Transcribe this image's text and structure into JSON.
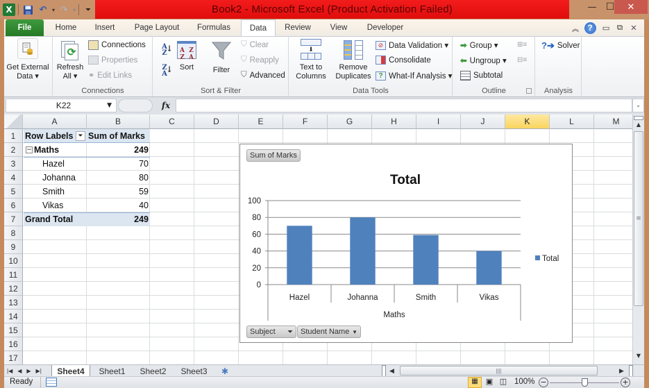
{
  "window": {
    "title": "Book2  -  Microsoft Excel (Product Activation Failed)",
    "title_color": "#e8141a",
    "minimize_label": "—",
    "maximize_label": "☐",
    "close_label": "✕"
  },
  "quick_access": {
    "excel_icon": "X",
    "save_icon": "💾",
    "undo_icon": "↶",
    "redo_icon": "↷",
    "customize_icon": "⏷"
  },
  "tabs": [
    {
      "label": "File"
    },
    {
      "label": "Home"
    },
    {
      "label": "Insert"
    },
    {
      "label": "Page Layout"
    },
    {
      "label": "Formulas"
    },
    {
      "label": "Data"
    },
    {
      "label": "Review"
    },
    {
      "label": "View"
    },
    {
      "label": "Developer"
    }
  ],
  "ribbon_right_icons": {
    "collapse": "︽",
    "help": "?",
    "minimize": "▭",
    "restore": "⧉",
    "close": "✕"
  },
  "ribbon": {
    "get_external_data": {
      "line1": "Get External",
      "line2": "Data ▾"
    },
    "connections_group": {
      "label": "Connections",
      "refresh_all": {
        "line1": "Refresh",
        "line2": "All ▾"
      },
      "connections": "Connections",
      "properties": "Properties",
      "edit_links": "Edit Links"
    },
    "sort_filter_group": {
      "label": "Sort & Filter",
      "sort_az": "A↓Z",
      "sort_za": "Z↓A",
      "sort": "Sort",
      "filter": "Filter",
      "clear": "Clear",
      "reapply": "Reapply",
      "advanced": "Advanced"
    },
    "data_tools_group": {
      "label": "Data Tools",
      "text_to_columns": {
        "line1": "Text to",
        "line2": "Columns"
      },
      "remove_duplicates": {
        "line1": "Remove",
        "line2": "Duplicates"
      },
      "data_validation": "Data Validation ▾",
      "consolidate": "Consolidate",
      "what_if": "What-If Analysis ▾"
    },
    "outline_group": {
      "label": "Outline",
      "group": "Group ▾",
      "ungroup": "Ungroup ▾",
      "subtotal": "Subtotal"
    },
    "analysis_group": {
      "label": "Analysis",
      "solver": "Solver"
    }
  },
  "formula_bar": {
    "name_box": "K22",
    "fx_label": "fx",
    "formula": ""
  },
  "columns": [
    "A",
    "B",
    "C",
    "D",
    "E",
    "F",
    "G",
    "H",
    "I",
    "J",
    "K",
    "L",
    "M"
  ],
  "selected_column": "K",
  "rows": [
    "1",
    "2",
    "3",
    "4",
    "5",
    "6",
    "7",
    "8",
    "9",
    "10",
    "11",
    "12",
    "13",
    "14",
    "15",
    "16",
    "17"
  ],
  "pivot_table": {
    "header_row_labels": "Row Labels",
    "header_sum": "Sum of Marks",
    "group": {
      "label": "Maths",
      "value": "249",
      "collapse_icon": "⊟"
    },
    "items": [
      {
        "label": "Hazel",
        "value": "70"
      },
      {
        "label": "Johanna",
        "value": "80"
      },
      {
        "label": "Smith",
        "value": "59"
      },
      {
        "label": "Vikas",
        "value": "40"
      }
    ],
    "grand_total": {
      "label": "Grand Total",
      "value": "249"
    }
  },
  "chart_data": {
    "type": "bar",
    "title": "Total",
    "categories": [
      "Hazel",
      "Johanna",
      "Smith",
      "Vikas"
    ],
    "group_label": "Maths",
    "series": [
      {
        "name": "Total",
        "values": [
          70,
          80,
          59,
          40
        ],
        "color": "#4f81bd"
      }
    ],
    "ylim": [
      0,
      100
    ],
    "yticks": [
      0,
      20,
      40,
      60,
      80,
      100
    ],
    "xlabel": "",
    "ylabel": "",
    "grid": true,
    "legend": "right",
    "field_buttons": {
      "value": "Sum of Marks",
      "axis1": "Subject",
      "axis2": "Student Name"
    }
  },
  "sheets": {
    "active": "Sheet4",
    "tabs": [
      "Sheet4",
      "Sheet1",
      "Sheet2",
      "Sheet3"
    ]
  },
  "status": {
    "ready": "Ready",
    "zoom": "100%",
    "zoom_level_percent": 100
  }
}
